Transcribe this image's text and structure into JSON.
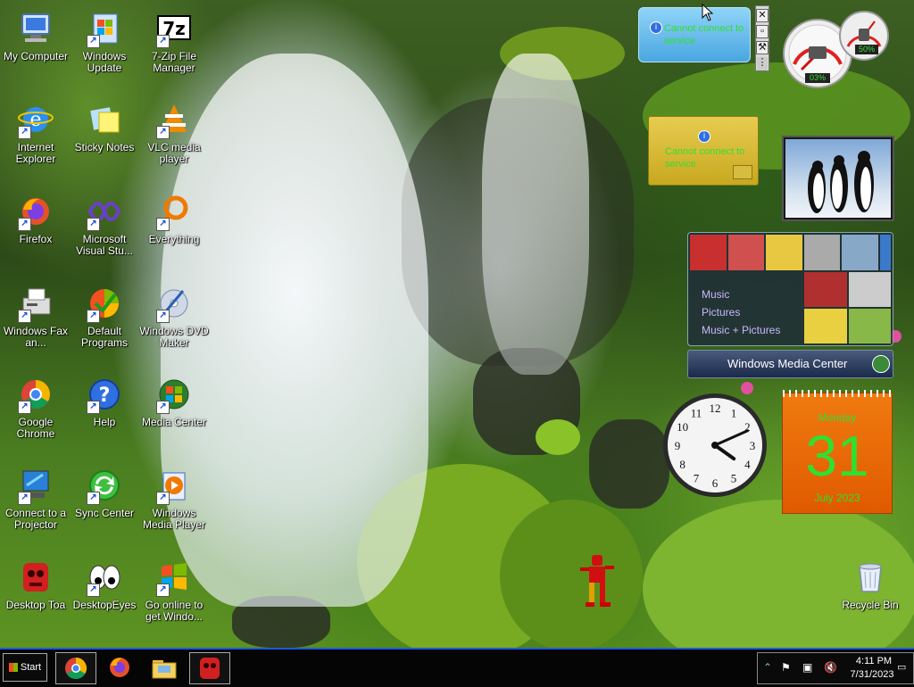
{
  "desktop_icons": [
    {
      "label": "My Computer",
      "icon": "computer-icon"
    },
    {
      "label": "Windows Update",
      "icon": "windows-update-icon"
    },
    {
      "label": "7-Zip File Manager",
      "icon": "7zip-icon"
    },
    {
      "label": "Internet Explorer",
      "icon": "ie-icon"
    },
    {
      "label": "Sticky Notes",
      "icon": "sticky-notes-icon"
    },
    {
      "label": "VLC media player",
      "icon": "vlc-icon"
    },
    {
      "label": "Firefox",
      "icon": "firefox-icon"
    },
    {
      "label": "Microsoft Visual Stu...",
      "icon": "visual-studio-icon"
    },
    {
      "label": "Everything",
      "icon": "everything-icon"
    },
    {
      "label": "Windows Fax an...",
      "icon": "fax-icon"
    },
    {
      "label": "Default Programs",
      "icon": "default-programs-icon"
    },
    {
      "label": "Windows DVD Maker",
      "icon": "dvd-maker-icon"
    },
    {
      "label": "Google Chrome",
      "icon": "chrome-icon"
    },
    {
      "label": "Help",
      "icon": "help-icon"
    },
    {
      "label": "Media Center",
      "icon": "media-center-icon"
    },
    {
      "label": "Connect to a Projector",
      "icon": "projector-icon"
    },
    {
      "label": "Sync Center",
      "icon": "sync-center-icon"
    },
    {
      "label": "Windows Media Player",
      "icon": "media-player-icon"
    },
    {
      "label": "Desktop Toa",
      "icon": "desktop-toa-icon"
    },
    {
      "label": "DesktopEyes",
      "icon": "desktop-eyes-icon"
    },
    {
      "label": "Go online to get Windo...",
      "icon": "windows-online-icon"
    }
  ],
  "recycle_bin": {
    "label": "Recycle Bin"
  },
  "gadgets": {
    "weather_error": "Cannot connect to service",
    "currency_error": "Cannot connect to service",
    "cpu_meter": {
      "cpu": "03%",
      "memory": "50%"
    },
    "media_center": {
      "items": [
        "Music",
        "Pictures",
        "Music + Pictures"
      ],
      "brand": "Windows Media Center"
    },
    "calendar": {
      "day_name": "Monday",
      "day": "31",
      "month_year": "July 2023"
    },
    "analog_clock": {
      "numbers": [
        "12",
        "1",
        "2",
        "3",
        "4",
        "5",
        "6",
        "7",
        "8",
        "9",
        "10",
        "11"
      ],
      "hour": 4,
      "minute": 11
    }
  },
  "taskbar": {
    "start_label": "Start",
    "clock_time": "4:11 PM",
    "clock_date": "7/31/2023"
  }
}
